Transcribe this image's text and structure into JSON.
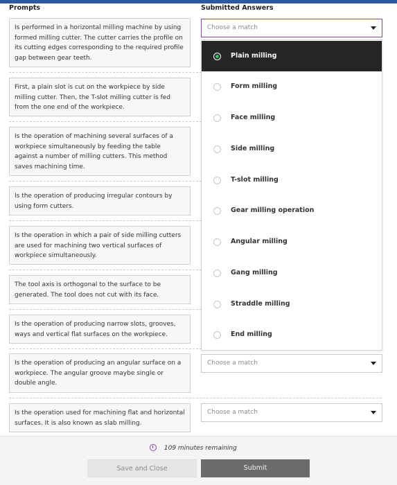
{
  "headers": {
    "prompts": "Prompts",
    "answers": "Submitted Answers"
  },
  "prompts": [
    "Is performed in a horizontal milling machine by using formed milling cutter. The cutter carries the profile on its cutting edges corresponding to the required profile gap between gear teeth.",
    "First, a plain slot is cut on the workpiece by side milling cutter. Then, the T-slot milling cutter is fed from the one end of the workpiece.",
    "Is the operation of machining several surfaces of a workpiece simultaneously by feeding the table against a number of milling cutters. This method saves machining time.",
    "Is the operation of producing irregular contours by using form cutters.",
    "Is the operation in which a pair of side milling cutters are used for machining two vertical surfaces of workpiece simultaneously.",
    "The tool axis is orthogonal to the surface to be generated. The tool does not cut with its face.",
    "Is the operation of producing narrow slots, grooves, ways and vertical flat surfaces on the workpiece.",
    "Is the operation of producing an angular surface on a workpiece. The angular groove maybe single or double angle.",
    "Is the operation used for machining flat and horizontal surfaces. It is also known as slab milling."
  ],
  "select_placeholder": "Choose a match",
  "dropdown_options": [
    "Plain milling",
    "Form milling",
    "Face milling",
    "Side milling",
    "T-slot milling",
    "Gear milling operation",
    "Angular milling",
    "Gang milling",
    "Straddle milling",
    "End milling"
  ],
  "selected_option": "Plain milling",
  "footer": {
    "timer": "109 minutes remaining",
    "save_label": "Save and Close",
    "submit_label": "Submit"
  },
  "colors": {
    "accent": "#8a3fb0",
    "selected_bg": "#262626",
    "radio_on": "#2ec866",
    "topbar": "#2c5aa0"
  }
}
